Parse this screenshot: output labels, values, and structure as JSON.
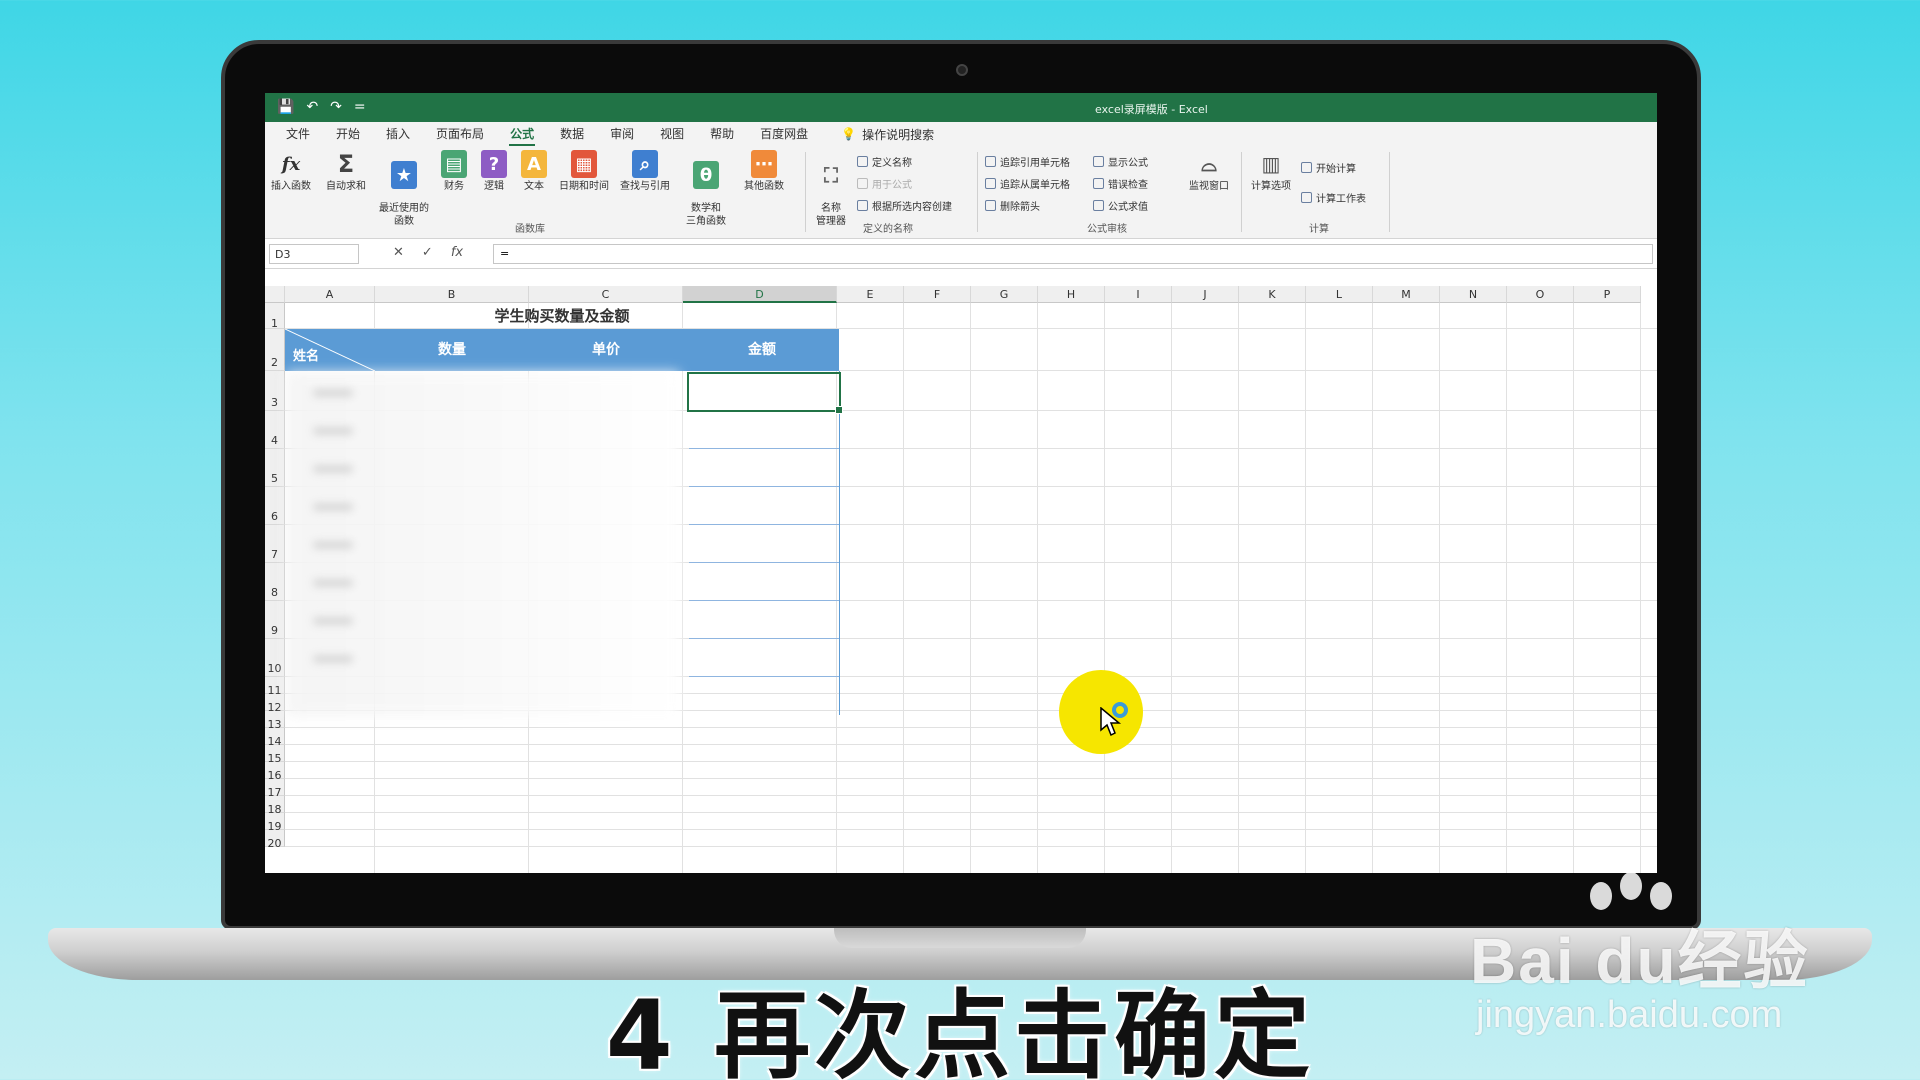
{
  "window": {
    "title": "excel录屏模版 - Excel"
  },
  "quick_access": [
    "💾",
    "↶",
    "↷",
    "="
  ],
  "menu": {
    "tabs": [
      "文件",
      "开始",
      "插入",
      "页面布局",
      "公式",
      "数据",
      "审阅",
      "视图",
      "帮助",
      "百度网盘"
    ],
    "active_tab": "公式",
    "search_label": "操作说明搜索"
  },
  "ribbon": {
    "function_library": {
      "group_label": "函数库",
      "buttons": [
        "插入函数",
        "自动求和",
        "最近使用的\n函数",
        "财务",
        "逻辑",
        "文本",
        "日期和时间",
        "查找与引用",
        "数学和\n三角函数",
        "其他函数"
      ]
    },
    "defined_names": {
      "group_label": "定义的名称",
      "manager": "名称\n管理器",
      "items": [
        "定义名称",
        "用于公式",
        "根据所选内容创建"
      ]
    },
    "formula_auditing": {
      "group_label": "公式审核",
      "items": [
        "追踪引用单元格",
        "追踪从属单元格",
        "删除箭头",
        "显示公式",
        "错误检查",
        "公式求值"
      ],
      "watch": "监视窗口"
    },
    "calculation": {
      "group_label": "计算",
      "options": "计算选项",
      "items": [
        "开始计算",
        "计算工作表"
      ]
    }
  },
  "formula_bar": {
    "name_box": "D3",
    "content": "="
  },
  "sheet": {
    "columns": [
      "A",
      "B",
      "C",
      "D",
      "E",
      "F",
      "G",
      "H",
      "I",
      "J",
      "K",
      "L",
      "M",
      "N",
      "O",
      "P"
    ],
    "selected_column": "D",
    "rows": [
      "1",
      "2",
      "3",
      "4",
      "5",
      "6",
      "7",
      "8",
      "9",
      "10",
      "11",
      "12",
      "13",
      "14",
      "15",
      "16",
      "17",
      "18",
      "19",
      "20"
    ],
    "table_title": "学生购买数量及金额",
    "headers": {
      "name": "姓名",
      "quantity": "数量",
      "unit_price": "单价",
      "amount": "金额"
    },
    "header_color": "#5b9bd5",
    "active_cell": "D3"
  },
  "caption": "4 再次点击确定",
  "watermark": {
    "brand": "Bai du经验",
    "url": "jingyan.baidu.com"
  }
}
